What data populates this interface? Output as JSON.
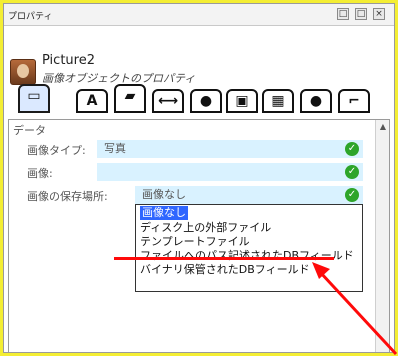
{
  "window": {
    "title": "プロパティ",
    "buttons": [
      "□",
      "□",
      "×"
    ]
  },
  "header": {
    "name": "Picture2",
    "subtitle": "画像オブジェクトのプロパティ"
  },
  "tabs": [
    {
      "icon": "image-tab-icon",
      "glyph": "▭"
    },
    {
      "icon": "font-tab-icon",
      "glyph": "A"
    },
    {
      "icon": "picture-tab-icon",
      "glyph": "▰"
    },
    {
      "icon": "ruler-tab-icon",
      "glyph": "⟷"
    },
    {
      "icon": "eye-tab-icon",
      "glyph": "●"
    },
    {
      "icon": "layers-tab-icon",
      "glyph": "▣"
    },
    {
      "icon": "grid-tab-icon",
      "glyph": "▦"
    },
    {
      "icon": "comment-tab-icon",
      "glyph": "●"
    },
    {
      "icon": "script-tab-icon",
      "glyph": "⌐"
    }
  ],
  "section": {
    "label": "データ"
  },
  "rows": [
    {
      "label": "画像タイプ:",
      "value": "写真"
    },
    {
      "label": "画像:",
      "value": ""
    },
    {
      "label": "画像の保存場所:",
      "value": "画像なし"
    }
  ],
  "dropdown": {
    "options": [
      "画像なし",
      "ディスク上の外部ファイル",
      "テンプレートファイル",
      "ファイルへのパス記述されたDBフィールド",
      "バイナリ保管されたDBフィールド"
    ],
    "selected_index": 0
  },
  "colors": {
    "background": "#f4ee33",
    "field_bg": "#d9f2ff",
    "selection": "#2f66ff",
    "annotation": "#ff0a0a",
    "ok_icon": "#2ea52a"
  }
}
